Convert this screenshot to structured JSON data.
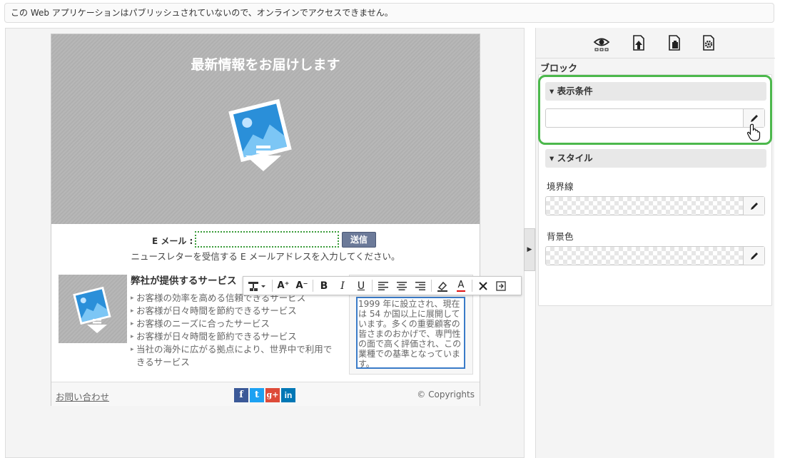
{
  "notice": "この Web アプリケーションはパブリッシュされていないので、オンラインでアクセスできません。",
  "canvas": {
    "hero_title": "最新情報をお届けします",
    "email_label": "E メール :",
    "email_value": "",
    "send_label": "送信",
    "email_help": "ニュースレターを受信する E メールアドレスを入力してください。",
    "services_title": "弊社が提供するサービス",
    "services": [
      "お客様の効率を高める信頼できるサービス",
      "お客様が日々時間を節約できるサービス",
      "お客様のニーズに合ったサービス",
      "お客様が日々時間を節約できるサービス",
      "当社の海外に広がる拠点により、世界中で利用できるサービス"
    ],
    "side_text": "1999 年に設立され、現在は 54 か国以上に展開しています。多くの重要顧客の皆さまのおかげで、専門性の面で高く評価され、この業種での基準となっています。",
    "footer": {
      "contact": "お問い合わせ",
      "copyright": "© Copyrights",
      "social": [
        "f",
        "t",
        "g+",
        "in"
      ]
    }
  },
  "toolbar": {
    "buttons": [
      "insert-dropdown",
      "font-grow",
      "font-shrink",
      "bold",
      "italic",
      "underline",
      "align-left",
      "align-center",
      "align-right",
      "highlight",
      "font-color",
      "remove-format",
      "exit"
    ],
    "font_grow_label": "A⁺",
    "font_shrink_label": "A⁻",
    "bold_label": "B",
    "italic_label": "I",
    "underline_label": "U",
    "font_color_label": "A"
  },
  "panel": {
    "icons": [
      "eye-icon",
      "upload-page-icon",
      "paste-page-icon",
      "settings-page-icon"
    ],
    "section_title": "ブロック",
    "groups": {
      "display_condition": "▾ 表示条件",
      "style": "▾ スタイル"
    },
    "display_condition_value": "",
    "border_label": "境界線",
    "background_label": "背景色"
  },
  "colors": {
    "highlight_border": "#4cb84c",
    "send_button": "#6c7a99",
    "text_box_border": "#3a7bc8",
    "facebook": "#3b5998",
    "twitter": "#1da1f2",
    "googleplus": "#dd4b39",
    "linkedin": "#0077b5"
  }
}
